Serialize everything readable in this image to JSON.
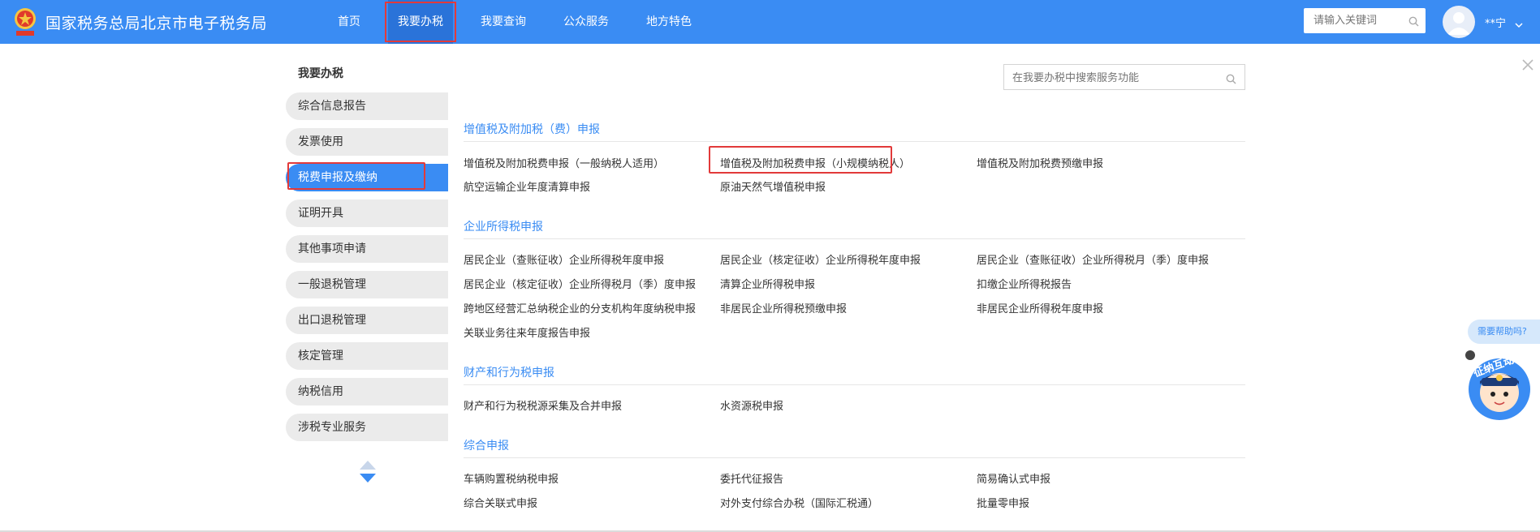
{
  "brand": {
    "title": "国家税务总局北京市电子税务局"
  },
  "nav": [
    {
      "label": "首页"
    },
    {
      "label": "我要办税"
    },
    {
      "label": "我要查询"
    },
    {
      "label": "公众服务"
    },
    {
      "label": "地方特色"
    }
  ],
  "header_search": {
    "placeholder": "请输入关键词"
  },
  "user": {
    "name": "**宁"
  },
  "sidebar": {
    "title": "我要办税",
    "items": [
      {
        "label": "综合信息报告"
      },
      {
        "label": "发票使用"
      },
      {
        "label": "税费申报及缴纳"
      },
      {
        "label": "证明开具"
      },
      {
        "label": "其他事项申请"
      },
      {
        "label": "一般退税管理"
      },
      {
        "label": "出口退税管理"
      },
      {
        "label": "核定管理"
      },
      {
        "label": "纳税信用"
      },
      {
        "label": "涉税专业服务"
      }
    ]
  },
  "service_search": {
    "placeholder": "在我要办税中搜索服务功能"
  },
  "sections": [
    {
      "title": "增值税及附加税（费）申报",
      "items": [
        "增值税及附加税费申报（一般纳税人适用）",
        "增值税及附加税费申报（小规模纳税人）",
        "增值税及附加税费预缴申报",
        "航空运输企业年度清算申报",
        "原油天然气增值税申报"
      ]
    },
    {
      "title": "企业所得税申报",
      "items": [
        "居民企业（查账征收）企业所得税年度申报",
        "居民企业（核定征收）企业所得税年度申报",
        "居民企业（查账征收）企业所得税月（季）度申报",
        "居民企业（核定征收）企业所得税月（季）度申报",
        "清算企业所得税申报",
        "扣缴企业所得税报告",
        "跨地区经营汇总纳税企业的分支机构年度纳税申报",
        "非居民企业所得税预缴申报",
        "非居民企业所得税年度申报",
        "关联业务往来年度报告申报"
      ]
    },
    {
      "title": "财产和行为税申报",
      "items": [
        "财产和行为税税源采集及合并申报",
        "水资源税申报"
      ]
    },
    {
      "title": "综合申报",
      "items": [
        "车辆购置税纳税申报",
        "委托代征报告",
        "简易确认式申报",
        "综合关联式申报",
        "对外支付综合办税（国际汇税通）",
        "批量零申报"
      ]
    }
  ],
  "help": {
    "label": "需要帮助吗?",
    "mascot_text": "征纳互动"
  },
  "colors": {
    "primary": "#3a8cf3",
    "highlight": "#e23a3a",
    "sidebar_bg": "#ebebeb"
  }
}
